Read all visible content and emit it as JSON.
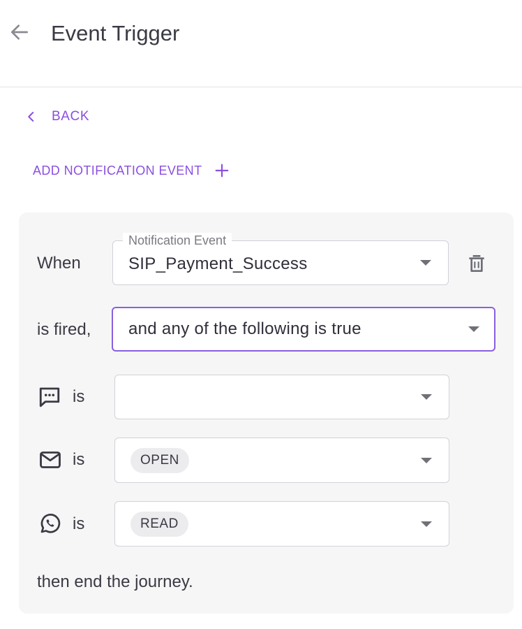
{
  "header": {
    "title": "Event Trigger"
  },
  "nav": {
    "back_label": "BACK"
  },
  "actions": {
    "add_event_label": "ADD NOTIFICATION EVENT"
  },
  "rule": {
    "when_label": "When",
    "event_field": {
      "label": "Notification Event",
      "value": "SIP_Payment_Success"
    },
    "fired_label": "is fired,",
    "condition_field": {
      "value": "and any of the following is true"
    },
    "conditions": [
      {
        "channel_icon": "sms-icon",
        "is_label": "is",
        "value": ""
      },
      {
        "channel_icon": "email-icon",
        "is_label": "is",
        "value": "OPEN"
      },
      {
        "channel_icon": "whatsapp-icon",
        "is_label": "is",
        "value": "READ"
      }
    ],
    "end_label": "then end the journey."
  },
  "colors": {
    "accent": "#8a4fe0",
    "panel_bg": "#f6f6f7",
    "chip_bg": "#ececee"
  }
}
